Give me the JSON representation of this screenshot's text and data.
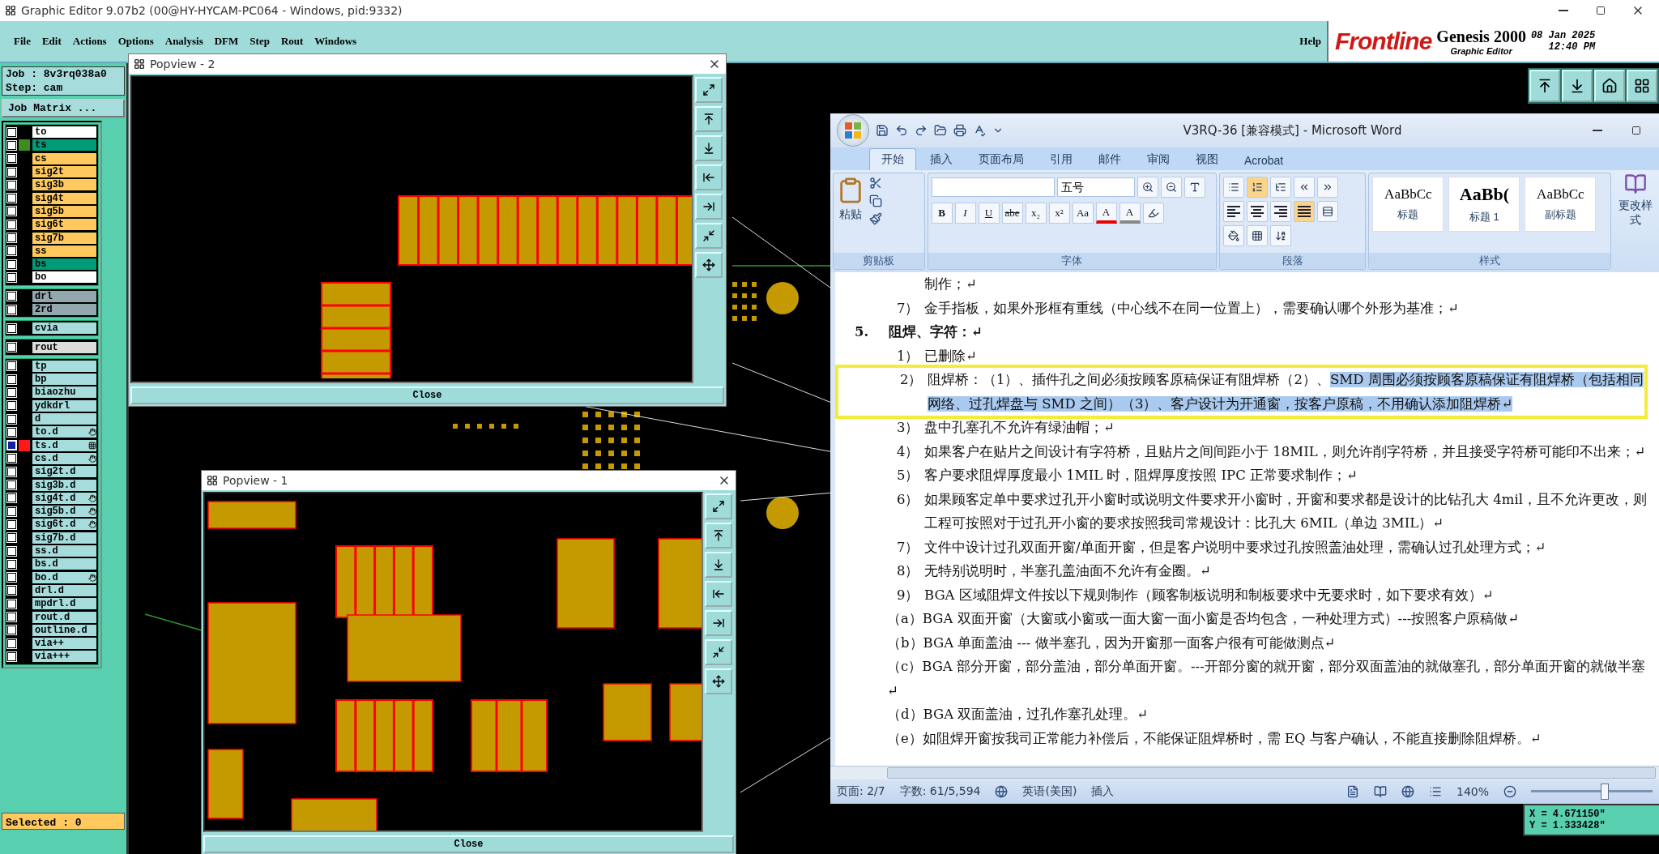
{
  "app_title": "Graphic Editor 9.07b2 (00@HY-HYCAM-PC064 - Windows, pid:9332)",
  "menu": [
    "File",
    "Edit",
    "Actions",
    "Options",
    "Analysis",
    "DFM",
    "Step",
    "Rout",
    "Windows"
  ],
  "help": "Help",
  "brand": {
    "logo": "Frontline",
    "product": "Genesis 2000",
    "subtitle": "Graphic Editor",
    "date": "08 Jan 2025",
    "time": "12:40 PM"
  },
  "job": {
    "job": "Job : 8v3rq038a0",
    "step": "Step: cam",
    "matrix_button": "Job Matrix ..."
  },
  "layer_groups": [
    [
      {
        "name": "to",
        "color": "#ffffff",
        "selected": false
      },
      {
        "name": "ts",
        "color": "#009b77",
        "selected": false,
        "swatch": {
          "color": "#3c8c1e"
        }
      },
      {
        "name": "cs",
        "color": "#ffc95e",
        "selected": false
      },
      {
        "name": "sig2t",
        "color": "#ffc95e",
        "selected": false
      },
      {
        "name": "sig3b",
        "color": "#ffc95e",
        "selected": false
      },
      {
        "name": "sig4t",
        "color": "#ffc95e",
        "selected": false
      },
      {
        "name": "sig5b",
        "color": "#ffc95e",
        "selected": false
      },
      {
        "name": "sig6t",
        "color": "#ffc95e",
        "selected": false
      },
      {
        "name": "sig7b",
        "color": "#ffc95e",
        "selected": false
      },
      {
        "name": "ss",
        "color": "#ffc95e",
        "selected": false
      },
      {
        "name": "bs",
        "color": "#009b77",
        "selected": false
      },
      {
        "name": "bo",
        "color": "#ffffff",
        "selected": false
      }
    ],
    [
      {
        "name": "drl",
        "color": "#93a7ae",
        "selected": false
      },
      {
        "name": "2rd",
        "color": "#93a7ae",
        "selected": false
      }
    ],
    [
      {
        "name": "cvia",
        "color": "#a6dcdc",
        "selected": false
      }
    ],
    [
      {
        "name": "rout",
        "color": "#dcdcdc",
        "selected": false
      }
    ],
    [
      {
        "name": "tp",
        "color": "#a6dcdc",
        "selected": false
      },
      {
        "name": "bp",
        "color": "#a6dcdc",
        "selected": false
      },
      {
        "name": "biaozhu",
        "color": "#a6dcdc",
        "selected": false
      },
      {
        "name": "ydkdrl",
        "color": "#a6dcdc",
        "selected": false
      },
      {
        "name": "d",
        "color": "#a6dcdc",
        "selected": false
      },
      {
        "name": "to.d",
        "color": "#a6dcdc",
        "selected": false,
        "marker": {
          "kind": "hand"
        }
      },
      {
        "name": "ts.d",
        "color": "#a6dcdc",
        "selected": true,
        "swatch": {
          "color": "#ff1a1a"
        },
        "marker": {
          "kind": "grid"
        }
      },
      {
        "name": "cs.d",
        "color": "#a6dcdc",
        "selected": false,
        "marker": {
          "kind": "hand"
        }
      },
      {
        "name": "sig2t.d",
        "color": "#a6dcdc",
        "selected": false
      },
      {
        "name": "sig3b.d",
        "color": "#a6dcdc",
        "selected": false
      },
      {
        "name": "sig4t.d",
        "color": "#a6dcdc",
        "selected": false,
        "marker": {
          "kind": "hand"
        }
      },
      {
        "name": "sig5b.d",
        "color": "#a6dcdc",
        "selected": false,
        "marker": {
          "kind": "hand"
        }
      },
      {
        "name": "sig6t.d",
        "color": "#a6dcdc",
        "selected": false,
        "marker": {
          "kind": "hand"
        }
      },
      {
        "name": "sig7b.d",
        "color": "#a6dcdc",
        "selected": false
      },
      {
        "name": "ss.d",
        "color": "#a6dcdc",
        "selected": false
      },
      {
        "name": "bs.d",
        "color": "#a6dcdc",
        "selected": false
      },
      {
        "name": "bo.d",
        "color": "#a6dcdc",
        "selected": false,
        "marker": {
          "kind": "hand"
        }
      },
      {
        "name": "drl.d",
        "color": "#a6dcdc",
        "selected": false
      },
      {
        "name": "mpdrl.d",
        "color": "#a6dcdc",
        "selected": false
      },
      {
        "name": "rout.d",
        "color": "#a6dcdc",
        "selected": false
      },
      {
        "name": "outline.d",
        "color": "#a6dcdc",
        "selected": false
      },
      {
        "name": "via++",
        "color": "#a6dcdc",
        "selected": false
      },
      {
        "name": "via+++",
        "color": "#a6dcdc",
        "selected": false
      }
    ]
  ],
  "selected_count": "Selected : 0",
  "popviews": [
    {
      "title": "Popview - 2",
      "close": "Close"
    },
    {
      "title": "Popview - 1",
      "close": "Close"
    }
  ],
  "word": {
    "title": "V3RQ-36 [兼容模式] - Microsoft Word",
    "tabs": [
      {
        "label": "开始",
        "selected": true
      },
      {
        "label": "插入",
        "selected": false
      },
      {
        "label": "页面布局",
        "selected": false
      },
      {
        "label": "引用",
        "selected": false
      },
      {
        "label": "邮件",
        "selected": false
      },
      {
        "label": "审阅",
        "selected": false
      },
      {
        "label": "视图",
        "selected": false
      },
      {
        "label": "Acrobat",
        "selected": false
      }
    ],
    "ribbon": {
      "paste": "粘贴",
      "font_size": "五号",
      "font_buttons": [
        {
          "label": "B",
          "kind": "bold"
        },
        {
          "label": "I",
          "kind": "italic"
        },
        {
          "label": "U",
          "kind": "underline"
        },
        {
          "label": "abe",
          "kind": "strike"
        },
        {
          "label": "x₂",
          "kind": "plain"
        },
        {
          "label": "x²",
          "kind": "plain"
        },
        {
          "label": "Aa",
          "kind": "plain"
        },
        {
          "label": "A",
          "kind": "color"
        },
        {
          "label": "A",
          "kind": "shade"
        }
      ],
      "styles": [
        {
          "preview": "AaBbCc",
          "name": "标题"
        },
        {
          "preview": "AaBb(",
          "name": "标题 1"
        },
        {
          "preview": "AaBbCc",
          "name": "副标题"
        }
      ],
      "change_styles": "更改样式",
      "groups": [
        "剪贴板",
        "字体",
        "段落",
        "样式"
      ]
    },
    "paragraphs": [
      {
        "kind": "continuation",
        "text": "制作；↵"
      },
      {
        "kind": "item",
        "number": "7）",
        "text": "金手指板，如果外形框有重线（中心线不在同一位置上），需要确认哪个外形为基准；↵"
      },
      {
        "kind": "heading",
        "number": "5.",
        "text": "阻焊、字符：↵"
      },
      {
        "kind": "item",
        "number": "1）",
        "text": "已删除↵"
      },
      {
        "kind": "item",
        "number": "2）",
        "text": "阻焊桥：（1）、插件孔之间必须按顾客原稿保证有阻焊桥（2）、",
        "selected_text": "SMD 周围必须按顾客原稿保证有阻焊桥（包括相同网络、过孔焊盘与 SMD 之间）（3）、客户设计为开通窗，按客户原稿，不用确认添加阻焊桥↵",
        "highlighted": true
      },
      {
        "kind": "item",
        "number": "3）",
        "text": "盘中孔塞孔不允许有绿油帽；↵"
      },
      {
        "kind": "item",
        "number": "4）",
        "text": "如果客户在贴片之间设计有字符桥，且贴片之间间距小于 18MIL，则允许削字符桥，并且接受字符桥可能印不出来；↵"
      },
      {
        "kind": "item",
        "number": "5）",
        "text": "客户要求阻焊厚度最小 1MIL 时，阻焊厚度按照 IPC 正常要求制作；↵"
      },
      {
        "kind": "item",
        "number": "6）",
        "text": "如果顾客定单中要求过孔开小窗时或说明文件要求开小窗时，开窗和要求都是设计的比钻孔大 4mil，且不允许更改，则工程可按照对于过孔开小窗的要求按照我司常规设计：比孔大 6MIL（单边 3MIL）↵"
      },
      {
        "kind": "item",
        "number": "7）",
        "text": "文件中设计过孔双面开窗/单面开窗，但是客户说明中要求过孔按照盖油处理，需确认过孔处理方式；↵"
      },
      {
        "kind": "item",
        "number": "8）",
        "text": "无特别说明时，半塞孔盖油面不允许有金圈。↵"
      },
      {
        "kind": "item",
        "number": "9）",
        "text": "BGA 区域阻焊文件按以下规则制作（顾客制板说明和制板要求中无要求时，如下要求有效）↵"
      },
      {
        "kind": "subitem",
        "text": "（a）BGA 双面开窗（大窗或小窗或一面大窗一面小窗是否均包含，一种处理方式）---按照客户原稿做↵"
      },
      {
        "kind": "subitem",
        "text": "（b）BGA 单面盖油 --- 做半塞孔，因为开窗那一面客户很有可能做测点↵"
      },
      {
        "kind": "subitem",
        "text": "（c）BGA  部分开窗，部分盖油，部分单面开窗。---开部分窗的就开窗，部分双面盖油的就做塞孔，部分单面开窗的就做半塞↵"
      },
      {
        "kind": "subitem",
        "text": "（d）BGA 双面盖油，过孔作塞孔处理。↵"
      },
      {
        "kind": "subitem",
        "text": "（e）如阻焊开窗按我司正常能力补偿后，不能保证阻焊桥时，需 EQ 与客户确认，不能直接删除阻焊桥。↵"
      }
    ],
    "status": {
      "page": "页面: 2/7",
      "words": "字数: 61/5,594",
      "language": "英语(美国)",
      "mode": "插入",
      "zoom": "140%"
    },
    "zoom_slider": {
      "level": 0.6
    }
  },
  "coordinates": [
    "X = 4.671150\"",
    "Y = 1.333428\""
  ]
}
